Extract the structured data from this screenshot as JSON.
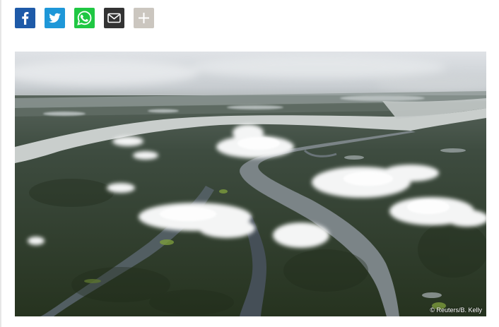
{
  "share": {
    "buttons": [
      {
        "network": "facebook",
        "icon": "facebook-icon",
        "color": "#1e5aa8"
      },
      {
        "network": "twitter",
        "icon": "twitter-bird-icon",
        "color": "#1e97d8"
      },
      {
        "network": "whatsapp",
        "icon": "whatsapp-icon",
        "color": "#1fc743"
      },
      {
        "network": "email",
        "icon": "envelope-icon",
        "color": "#333333"
      },
      {
        "network": "more",
        "icon": "plus-icon",
        "color": "#cbc6bf"
      }
    ]
  },
  "figure": {
    "credit": "© Reuters/B. Kelly",
    "caption": ""
  }
}
